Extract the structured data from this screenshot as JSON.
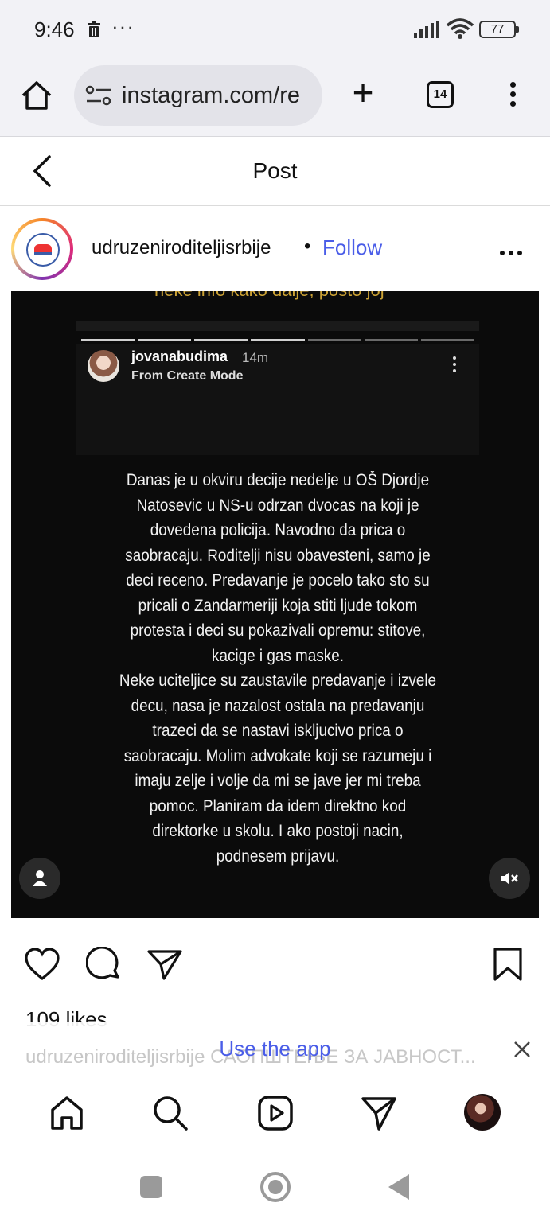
{
  "status_bar": {
    "time": "9:46",
    "dots": "···",
    "battery": "77",
    "icons": [
      "trash-icon",
      "signal-icon",
      "wifi-icon",
      "battery-icon"
    ]
  },
  "browser": {
    "url": "instagram.com/re",
    "tab_count": "14"
  },
  "post_header": {
    "title": "Post"
  },
  "author": {
    "username": "udruzeniroditeljisrbije",
    "separator": "•",
    "follow_label": "Follow"
  },
  "story": {
    "top_text": "neke info kako dalje, posto joj",
    "user": "jovanabudima",
    "time": "14m",
    "subtitle": "From Create Mode",
    "text": "Danas je u okviru decije nedelje u OŠ Djordje\nNatosevic u NS-u odrzan dvocas na koji je\ndovedena policija. Navodno da prica o\nsaobracaju. Roditelji nisu obavesteni, samo je\ndeci receno. Predavanje je pocelo tako sto su\npricali o Zandarmeriji koja stiti ljude tokom\nprotesta i deci su pokazivali opremu: stitove,\nkacige i gas maske.\nNeke uciteljice su zaustavile predavanje i izvele\ndecu, nasa je nazalost ostala na predavanju\ntrazeci da se nastavi iskljucivo prica o\nsaobracaju. Molim advokate koji se razumeju i\nimaju zelje i volje da mi se jave jer mi treba\npomoc. Planiram da idem direktno kod\ndirektorke u skolu. I ako postoji nacin,\npodnesem prijavu."
  },
  "post": {
    "likes": "109 likes",
    "caption_preview": "udruzeniroditeljisrbije САОПШТЕЊЕ ЗА ЈАВНОСТ..."
  },
  "banner": {
    "use_app_label": "Use the app"
  },
  "colors": {
    "accent": "#4a5de8",
    "story_bg": "#0b0b0b",
    "chrome_bg": "#f2f2f6"
  }
}
